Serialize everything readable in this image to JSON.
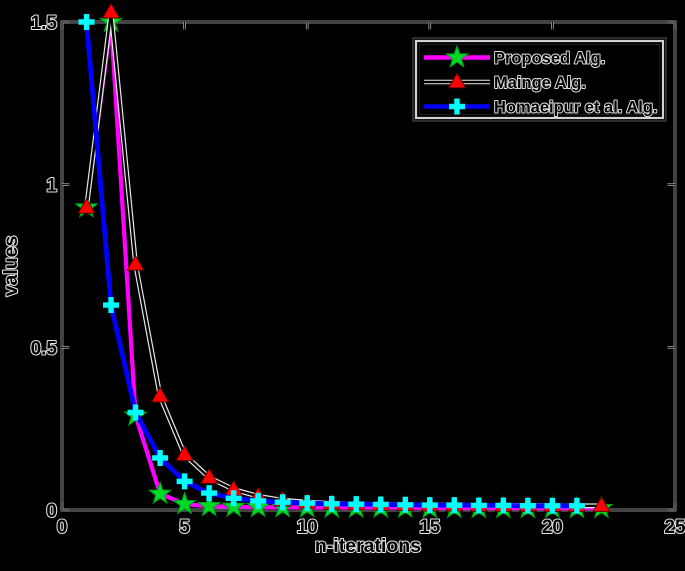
{
  "figure": {
    "background_color": "#000000",
    "text_color": "#000000",
    "text_outline_color": "#e4e4e4",
    "frame_color": "#a8a8a8"
  },
  "chart_data": {
    "type": "line",
    "title": "",
    "xlabel": "n-iterations",
    "ylabel": "values",
    "xlim": [
      0,
      25
    ],
    "ylim": [
      0,
      1.5
    ],
    "grid": false,
    "xticks": {
      "values": [
        0,
        5,
        10,
        15,
        20,
        25
      ],
      "labels": [
        "0",
        "5",
        "10",
        "15",
        "20",
        "25"
      ]
    },
    "yticks": {
      "values": [
        0,
        0.5,
        1,
        1.5
      ],
      "labels": [
        "0",
        "0.5",
        "1",
        "1.5"
      ]
    },
    "legend": {
      "position": "upper-right",
      "items": [
        {
          "label": "Proposed Alg.",
          "line_color": "#ff00ff",
          "marker": "star",
          "marker_color": "#00d926"
        },
        {
          "label": "Mainge Alg.",
          "line_color": "#000000",
          "outline_color": "#e8e8e8",
          "marker": "triangle",
          "marker_color": "#ff0000"
        },
        {
          "label": "Homaeipur et al. Alg.",
          "line_color": "#0000ff",
          "marker": "plus",
          "marker_color": "#00ffff"
        }
      ]
    },
    "series": [
      {
        "name": "Proposed Alg.",
        "line_color": "#ff00ff",
        "line_width": 4.2,
        "marker": "star",
        "marker_color": "#00d926",
        "x": [
          1,
          2,
          3,
          4,
          5,
          6,
          7,
          8,
          9,
          10,
          11,
          12,
          13,
          14,
          15,
          16,
          17,
          18,
          19,
          20,
          21,
          22
        ],
        "y": [
          0.93,
          1.5,
          0.29,
          0.05,
          0.018,
          0.012,
          0.01,
          0.009,
          0.008,
          0.008,
          0.007,
          0.007,
          0.007,
          0.007,
          0.006,
          0.006,
          0.006,
          0.006,
          0.006,
          0.006,
          0.006,
          0.006
        ]
      },
      {
        "name": "Mainge Alg.",
        "line_color": "#000000",
        "outline_color": "#e8e8e8",
        "line_width": 2.4,
        "marker": "triangle",
        "marker_color": "#ff0000",
        "x": [
          1,
          2,
          3,
          4,
          5,
          6,
          7,
          8,
          9,
          10,
          11,
          12,
          13,
          14,
          15,
          16,
          17,
          18,
          19,
          20,
          21,
          22
        ],
        "y": [
          0.93,
          1.53,
          0.755,
          0.35,
          0.17,
          0.1,
          0.063,
          0.042,
          0.03,
          0.024,
          0.02,
          0.018,
          0.017,
          0.016,
          0.015,
          0.015,
          0.014,
          0.014,
          0.014,
          0.013,
          0.013,
          0.013
        ]
      },
      {
        "name": "Homaeipur et al. Alg.",
        "line_color": "#0000ff",
        "line_width": 4.8,
        "marker": "plus",
        "marker_color": "#00ffff",
        "x": [
          1,
          2,
          3,
          4,
          5,
          6,
          7,
          8,
          9,
          10,
          11,
          12,
          13,
          14,
          15,
          16,
          17,
          18,
          19,
          20,
          21
        ],
        "y": [
          1.5,
          0.63,
          0.3,
          0.16,
          0.088,
          0.052,
          0.036,
          0.028,
          0.024,
          0.021,
          0.019,
          0.018,
          0.017,
          0.016,
          0.015,
          0.015,
          0.014,
          0.014,
          0.013,
          0.013,
          0.013
        ]
      }
    ]
  }
}
